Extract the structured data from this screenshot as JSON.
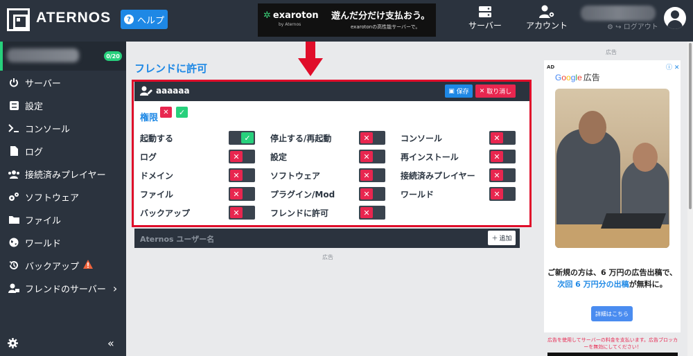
{
  "header": {
    "logo_text": "ATERNOS",
    "help_label": "ヘルプ",
    "top_ad": {
      "brand": "exaroton",
      "brand_sub": "by Aternos",
      "headline": "遊んだ分だけ支払おう。",
      "subline": "exarotonの高性能サーバーで。"
    },
    "nav_server": "サーバー",
    "nav_account": "アカウント",
    "logout": "ログアウト"
  },
  "sidebar": {
    "server_count": "0/20",
    "items": [
      {
        "label": "サーバー",
        "icon": "power-icon"
      },
      {
        "label": "設定",
        "icon": "sliders-icon"
      },
      {
        "label": "コンソール",
        "icon": "terminal-icon"
      },
      {
        "label": "ログ",
        "icon": "document-icon"
      },
      {
        "label": "接続済みプレイヤー",
        "icon": "users-icon"
      },
      {
        "label": "ソフトウェア",
        "icon": "cogs-icon"
      },
      {
        "label": "ファイル",
        "icon": "folder-icon"
      },
      {
        "label": "ワールド",
        "icon": "globe-icon"
      },
      {
        "label": "バックアップ",
        "icon": "history-icon"
      },
      {
        "label": "フレンドのサーバー",
        "icon": "user-lock-icon"
      }
    ]
  },
  "main": {
    "title": "フレンドに許可",
    "card": {
      "username": "aaaaaa",
      "save_label": "保存",
      "cancel_label": "取り消し",
      "permissions_label": "権限",
      "permissions": [
        {
          "label": "起動する",
          "enabled": true
        },
        {
          "label": "停止する/再起動",
          "enabled": false
        },
        {
          "label": "コンソール",
          "enabled": false
        },
        {
          "label": "ログ",
          "enabled": false
        },
        {
          "label": "設定",
          "enabled": false
        },
        {
          "label": "再インストール",
          "enabled": false
        },
        {
          "label": "ドメイン",
          "enabled": false
        },
        {
          "label": "ソフトウェア",
          "enabled": false
        },
        {
          "label": "接続済みプレイヤー",
          "enabled": false
        },
        {
          "label": "ファイル",
          "enabled": false
        },
        {
          "label": "プラグイン/Mod",
          "enabled": false
        },
        {
          "label": "ワールド",
          "enabled": false
        },
        {
          "label": "バックアップ",
          "enabled": false
        },
        {
          "label": "フレンドに許可",
          "enabled": false
        }
      ]
    },
    "add_user": {
      "placeholder": "Aternos ユーザー名",
      "add_label": "追加"
    },
    "ad_label": "広告"
  },
  "right_ad": {
    "top_label": "広告",
    "ad_tag": "AD",
    "google_ad": "広告",
    "text1": "ご新規の方は、6 万円の広告出稿で、",
    "text2_highlight": "次回 6 万円分の出稿",
    "text2_rest": "が無料に。",
    "cta": "詳細はこちら",
    "warning": "広告を使用してサーバーの料金を支払います。広告ブロッカーを無効にしてください！"
  },
  "colors": {
    "dark": "#2b333e",
    "accent": "#1e88e5",
    "green": "#27d07c",
    "red": "#e8264f",
    "highlight_frame": "#e00d2a"
  }
}
